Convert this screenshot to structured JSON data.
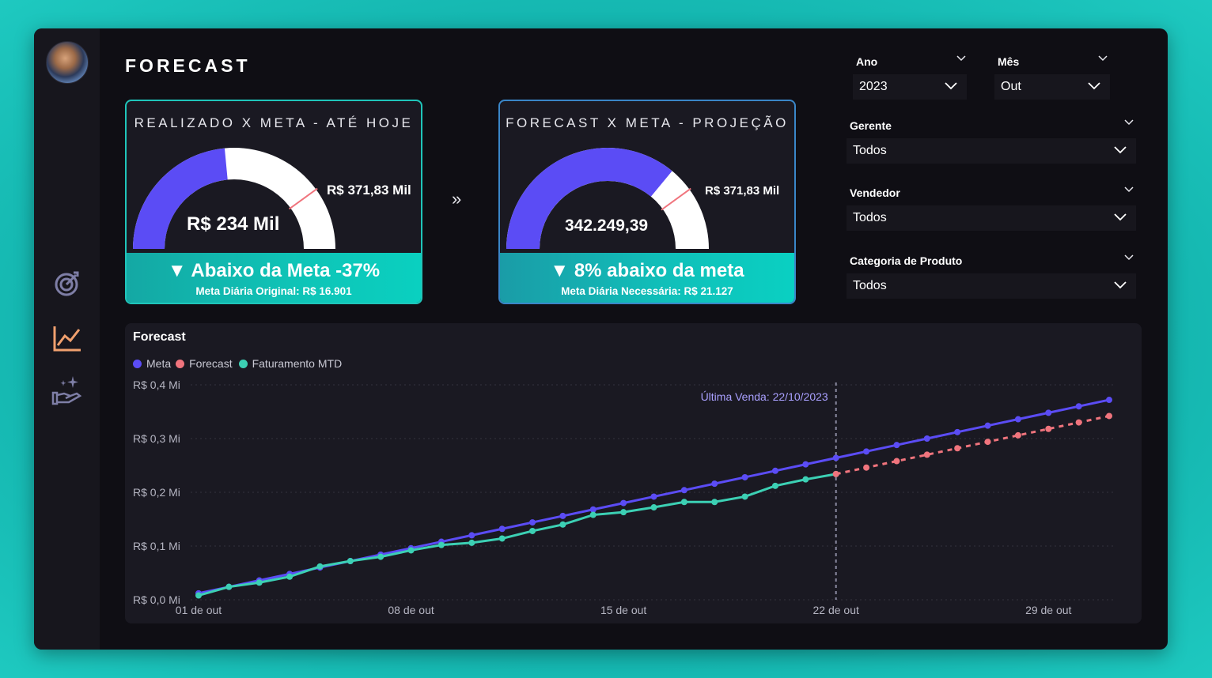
{
  "header": {
    "title": "FORECAST"
  },
  "rail": {
    "icons": [
      "target-icon",
      "line-chart-icon",
      "hand-sparkle-icon"
    ]
  },
  "card_realizado": {
    "title": "REALIZADO X META - ATÉ HOJE",
    "value": "R$ 234 Mil",
    "target": "R$ 371,83 Mil",
    "status": "▼ Abaixo da Meta -37%",
    "sub": "Meta Diária Original: R$ 16.901",
    "fill_fraction": 0.47,
    "target_fraction": 0.8
  },
  "arrows": "»",
  "card_forecast": {
    "title": "FORECAST X META - PROJEÇÃO",
    "value": "342.249,39",
    "target": "R$ 371,83 Mil",
    "status": "▼ 8% abaixo da meta",
    "sub": "Meta Diária Necessária: R$ 21.127",
    "fill_fraction": 0.72,
    "target_fraction": 0.8
  },
  "filters": {
    "ano": {
      "label": "Ano",
      "value": "2023"
    },
    "mes": {
      "label": "Mês",
      "value": "Out"
    },
    "gerente": {
      "label": "Gerente",
      "value": "Todos"
    },
    "vendedor": {
      "label": "Vendedor",
      "value": "Todos"
    },
    "categoria": {
      "label": "Categoria de Produto",
      "value": "Todos"
    }
  },
  "colors": {
    "meta": "#5b4cf5",
    "forecast": "#f0747d",
    "faturamento": "#3cd0b4",
    "gauge_fill": "#5b4cf5",
    "gauge_rest": "#ffffff"
  },
  "chart_data": {
    "type": "line",
    "title": "Forecast",
    "annotation": "Última Venda: 22/10/2023",
    "annotation_x": 22,
    "x_ticks": [
      {
        "day": 1,
        "label": "01 de out"
      },
      {
        "day": 8,
        "label": "08 de out"
      },
      {
        "day": 15,
        "label": "15 de out"
      },
      {
        "day": 22,
        "label": "22 de out"
      },
      {
        "day": 29,
        "label": "29 de out"
      }
    ],
    "y_ticks": [
      {
        "value": 0.0,
        "label": "R$ 0,0 Mi"
      },
      {
        "value": 0.1,
        "label": "R$ 0,1 Mi"
      },
      {
        "value": 0.2,
        "label": "R$ 0,2 Mi"
      },
      {
        "value": 0.3,
        "label": "R$ 0,3 Mi"
      },
      {
        "value": 0.4,
        "label": "R$ 0,4 Mi"
      }
    ],
    "ylim": [
      0,
      0.4
    ],
    "xlim": [
      1,
      31
    ],
    "series": [
      {
        "name": "Meta",
        "key": "meta",
        "x": [
          1,
          2,
          3,
          4,
          5,
          6,
          7,
          8,
          9,
          10,
          11,
          12,
          13,
          14,
          15,
          16,
          17,
          18,
          19,
          20,
          21,
          22,
          23,
          24,
          25,
          26,
          27,
          28,
          29,
          30,
          31
        ],
        "values": [
          0.012,
          0.024,
          0.036,
          0.048,
          0.06,
          0.072,
          0.084,
          0.096,
          0.108,
          0.12,
          0.132,
          0.144,
          0.156,
          0.168,
          0.18,
          0.192,
          0.204,
          0.216,
          0.228,
          0.24,
          0.252,
          0.264,
          0.276,
          0.288,
          0.3,
          0.312,
          0.324,
          0.336,
          0.348,
          0.36,
          0.372
        ],
        "style": "solid"
      },
      {
        "name": "Forecast",
        "key": "forecast",
        "x": [
          22,
          23,
          24,
          25,
          26,
          27,
          28,
          29,
          30,
          31
        ],
        "values": [
          0.234,
          0.246,
          0.258,
          0.27,
          0.282,
          0.294,
          0.306,
          0.318,
          0.33,
          0.342
        ],
        "style": "dashed"
      },
      {
        "name": "Faturamento MTD",
        "key": "faturamento",
        "x": [
          1,
          2,
          3,
          4,
          5,
          6,
          7,
          8,
          9,
          10,
          11,
          12,
          13,
          14,
          15,
          16,
          17,
          18,
          19,
          20,
          21,
          22
        ],
        "values": [
          0.008,
          0.024,
          0.032,
          0.043,
          0.062,
          0.072,
          0.08,
          0.092,
          0.102,
          0.106,
          0.114,
          0.128,
          0.14,
          0.158,
          0.163,
          0.172,
          0.182,
          0.182,
          0.192,
          0.212,
          0.224,
          0.234
        ],
        "style": "solid"
      }
    ],
    "grid": true,
    "legend_position": "top-left"
  }
}
